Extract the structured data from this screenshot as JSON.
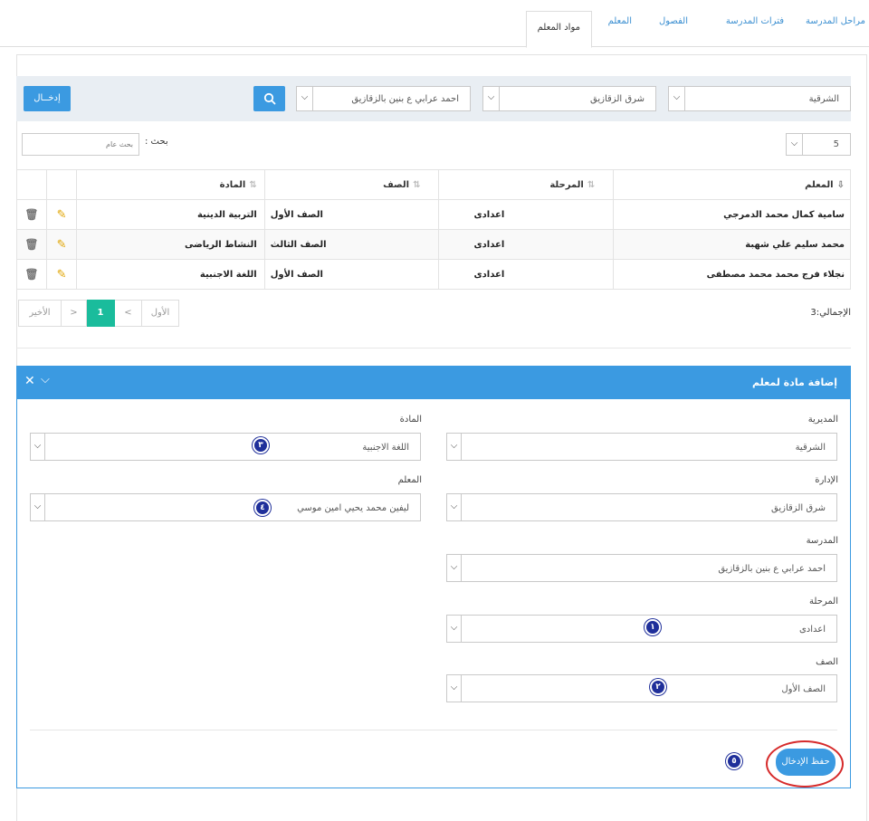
{
  "tabs": [
    {
      "label": "مراحل المدرسة"
    },
    {
      "label": "فترات المدرسة"
    },
    {
      "label": "الفصول"
    },
    {
      "label": "المعلم"
    },
    {
      "label": "مواد المعلم"
    }
  ],
  "filters": {
    "directorate": "الشرقية",
    "administration": "شرق الزقازيق",
    "school": "احمد عرابي ع بنين بالزقازيق",
    "enter_label": "إدخــال"
  },
  "list": {
    "page_size": "5",
    "search_label": "بحث :",
    "search_placeholder": "بحث عام"
  },
  "table": {
    "headers": [
      "المعلم",
      "المرحلة",
      "الصف",
      "المادة"
    ],
    "rows": [
      {
        "teacher": "سامية كمال محمد الدمرجي",
        "stage": "اعدادى",
        "grade": "الصف الأول",
        "subject": "التربية الدينية"
      },
      {
        "teacher": "محمد سليم علي شهبة",
        "stage": "اعدادى",
        "grade": "الصف الثالث",
        "subject": "النشاط الرياضى"
      },
      {
        "teacher": "نجلاء فرج محمد محمد مصطفى",
        "stage": "اعدادى",
        "grade": "الصف الأول",
        "subject": "اللغة الاجنبية"
      }
    ]
  },
  "pagination": {
    "total": "الإجمالي:3",
    "first": "الأول",
    "prev": "<",
    "current": "1",
    "next": ">",
    "last": "الأخير"
  },
  "form": {
    "title": "إضافة مادة لمعلم",
    "directorate_label": "المديرية",
    "directorate_value": "الشرقية",
    "administration_label": "الإدارة",
    "administration_value": "شرق الزقازيق",
    "school_label": "المدرسة",
    "school_value": "احمد عرابي ع بنين بالزقازيق",
    "stage_label": "المرحلة",
    "stage_value": "اعدادى",
    "grade_label": "الصف",
    "grade_value": "الصف الأول",
    "subject_label": "المادة",
    "subject_value": "اللغة الاجنبية",
    "teacher_label": "المعلم",
    "teacher_value": "ليفين محمد يحيي امين موسي",
    "save_label": "حفظ الإدخال"
  },
  "badges": [
    "١",
    "٢",
    "٣",
    "٤",
    "٥"
  ],
  "colors": {
    "accent": "#3b9ae1",
    "active_page": "#1abc9c",
    "badge": "#1f2f9a",
    "highlight": "#d62b2b"
  }
}
